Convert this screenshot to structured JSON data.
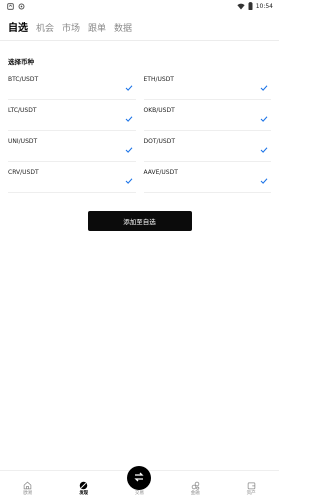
{
  "status_bar": {
    "time": "10:54"
  },
  "tabs": [
    {
      "label": "自选",
      "active": true
    },
    {
      "label": "机会",
      "active": false
    },
    {
      "label": "市场",
      "active": false
    },
    {
      "label": "跟单",
      "active": false
    },
    {
      "label": "数据",
      "active": false
    }
  ],
  "section_title": "选择币种",
  "coins": [
    {
      "label": "BTC/USDT",
      "checked": true
    },
    {
      "label": "ETH/USDT",
      "checked": true
    },
    {
      "label": "LTC/USDT",
      "checked": true
    },
    {
      "label": "OKB/USDT",
      "checked": true
    },
    {
      "label": "UNI/USDT",
      "checked": true
    },
    {
      "label": "DOT/USDT",
      "checked": true
    },
    {
      "label": "CRV/USDT",
      "checked": true
    },
    {
      "label": "AAVE/USDT",
      "checked": true
    }
  ],
  "add_button_label": "添加至自选",
  "bottom_nav": [
    {
      "label": "欧易",
      "icon": "home-icon",
      "active": false
    },
    {
      "label": "发现",
      "icon": "discover-icon",
      "active": true
    },
    {
      "label": "交易",
      "icon": "trade-swap-icon",
      "active": false
    },
    {
      "label": "金融",
      "icon": "finance-icon",
      "active": false
    },
    {
      "label": "资产",
      "icon": "wallet-icon",
      "active": false
    }
  ],
  "colors": {
    "accent": "#1a73e8",
    "primary_button": "#0b0b0b"
  }
}
